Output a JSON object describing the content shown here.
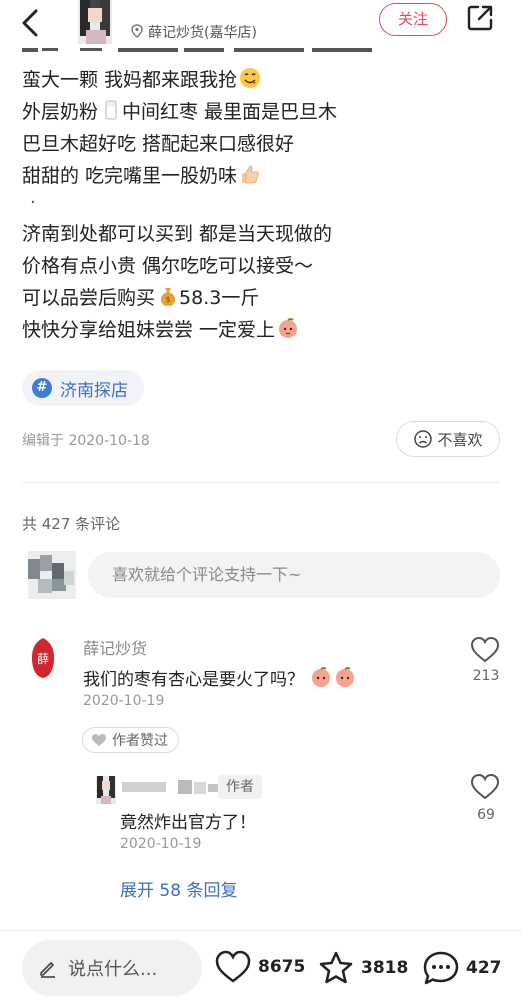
{
  "header": {
    "location_name": "薛记炒货(嘉华店)",
    "follow_label": "关注"
  },
  "post": {
    "lines": [
      "蛮大一颗 我妈都来跟我抢",
      "外层奶粉",
      "中间红枣 最里面是巴旦木",
      "巴旦木超好吃 搭配起来口感很好",
      "甜甜的 吃完嘴里一股奶味",
      "·",
      "济南到处都可以买到 都是当天现做的",
      "价格有点小贵 偶尔吃吃可以接受～",
      "可以品尝后购买",
      "58.3一斤",
      "快快分享给姐妹尝尝 一定爱上"
    ],
    "tag": "济南探店",
    "edited": "编辑于 2020-10-18",
    "dislike_label": "不喜欢"
  },
  "comments": {
    "count_label": "共 427 条评论",
    "input_placeholder": "喜欢就给个评论支持一下~",
    "first": {
      "author": "薛记炒货",
      "text": "我们的枣有杏心是要火了吗？",
      "date": "2020-10-19",
      "likes": "213",
      "author_liked_label": "作者赞过"
    },
    "reply": {
      "badge": "作者",
      "text": "竟然炸出官方了！",
      "date": "2020-10-19",
      "likes": "69"
    },
    "expand_label": "展开 58 条回复"
  },
  "bottom": {
    "say_placeholder": "说点什么...",
    "likes": "8675",
    "stars": "3818",
    "comments": "427"
  },
  "colors": {
    "accent": "#e8475c",
    "link": "#3f6ec0"
  }
}
